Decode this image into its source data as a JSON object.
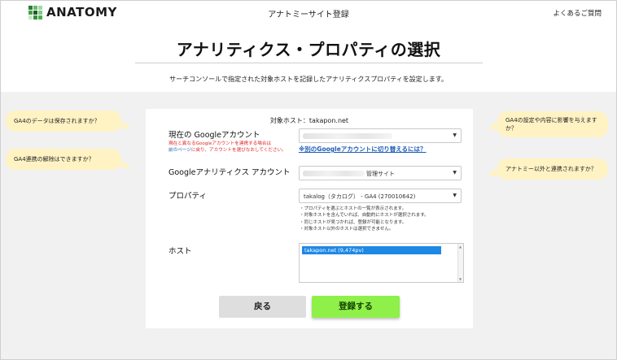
{
  "header": {
    "logo_text": "ANATOMY",
    "logo_colors": [
      "#2e7d32",
      "#66bb6a",
      "#a5d6a7",
      "#43a047",
      "#1b5e20",
      "#81c784",
      "#c8e6c9",
      "#388e3c",
      "#4caf50"
    ],
    "site_title": "アナトミーサイト登録",
    "faq_link": "よくあるご質問"
  },
  "page": {
    "title": "アナリティクス・プロパティの選択",
    "subtitle": "サーチコンソールで指定された対象ホストを記録したアナリティクスプロパティを設定します。"
  },
  "form": {
    "target_host": "対象ホスト：takapon.net",
    "google_account_label": "現在の Googleアカウント",
    "google_account_warning_line1": "現在と異なるGoogleアカウントを連携する場合は",
    "google_account_warning_link": "前のページ",
    "google_account_warning_line2": "に戻り、アカウントを選びなおしてください。",
    "switch_account_link": "※別のGoogleアカウントに切り替えるには？",
    "ga_account_label": "Googleアナリティクス アカウント",
    "ga_account_value": "管理サイト",
    "property_label": "プロパティ",
    "property_value": "takalog（タカログ） - GA4 (270010642)",
    "notes": [
      "・プロパティを選ぶとホストの一覧が表示されます。",
      "・対象ホストを含んでいれば、自動的にホストが選択されます。",
      "・同じホストが見つかれば、登録が可能となります。",
      "・対象ホスト以外のホストは選択できません。"
    ],
    "host_label": "ホスト",
    "host_option": "takapon.net (9,474pv)",
    "back_button": "戻る",
    "register_button": "登録する"
  },
  "faq": {
    "q1": "GA4のデータは保存されますか？",
    "q2": "GA4連携の解除はできますか？",
    "q3": "GA4の設定や内容に影響を与えますか？",
    "q4": "アナトミー以外と連携されますか？"
  }
}
